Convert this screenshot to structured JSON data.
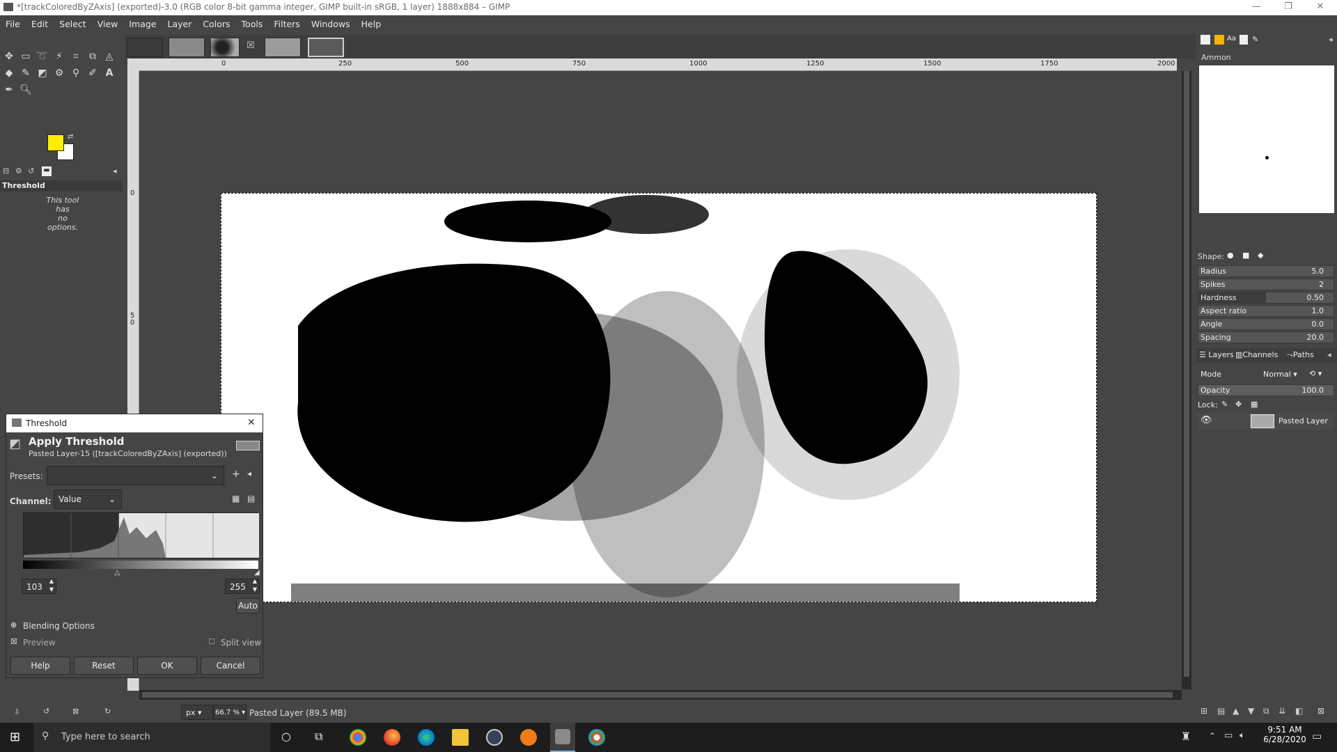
{
  "window": {
    "title": "*[trackColoredByZAxis] (exported)-3.0 (RGB color 8-bit gamma integer, GIMP built-in sRGB, 1 layer) 1888x884 – GIMP",
    "minimize": "—",
    "maximize": "❐",
    "close": "✕"
  },
  "menu": [
    "File",
    "Edit",
    "Select",
    "View",
    "Image",
    "Layer",
    "Colors",
    "Tools",
    "Filters",
    "Windows",
    "Help"
  ],
  "rulers": {
    "top": [
      "0",
      "250",
      "500",
      "750",
      "1000",
      "1250",
      "1500",
      "1750",
      "2000"
    ],
    "left": [
      "0",
      "5",
      "0"
    ]
  },
  "tool_options": {
    "title": "Threshold",
    "note_line1": "This tool has",
    "note_line2": "no options."
  },
  "statusbar": {
    "unit": "px",
    "zoom": "66.7 %",
    "layer_info": "Pasted Layer (89.5 MB)"
  },
  "brush": {
    "name": "Ammon",
    "shape_label": "Shape:",
    "sliders": [
      {
        "label": "Radius",
        "value": "5.0",
        "fraction": 0
      },
      {
        "label": "Spikes",
        "value": "2",
        "fraction": 0
      },
      {
        "label": "Hardness",
        "value": "0.50",
        "fraction": 0.5
      },
      {
        "label": "Aspect ratio",
        "value": "1.0",
        "fraction": 0
      },
      {
        "label": "Angle",
        "value": "0.0",
        "fraction": 0
      },
      {
        "label": "Spacing",
        "value": "20.0",
        "fraction": 0
      }
    ]
  },
  "layers": {
    "tabs": [
      "Layers",
      "Channels",
      "Paths"
    ],
    "mode_label": "Mode",
    "mode_value": "Normal",
    "opacity_label": "Opacity",
    "opacity_value": "100.0",
    "lock_label": "Lock:",
    "layer_name": "Pasted Layer"
  },
  "dialog": {
    "title": "Threshold",
    "heading": "Apply Threshold",
    "subheading": "Pasted Layer-15 ([trackColoredByZAxis] (exported))",
    "presets_label": "Presets:",
    "channel_label": "Channel:",
    "channel_value": "Value",
    "low": "103",
    "high": "255",
    "low_fraction": 0.404,
    "auto": "Auto",
    "blending": "Blending Options",
    "preview": "Preview",
    "split_view": "Split view",
    "buttons": {
      "help": "Help",
      "reset": "Reset",
      "ok": "OK",
      "cancel": "Cancel"
    }
  },
  "taskbar": {
    "search_placeholder": "Type here to search",
    "time": "9:51 AM",
    "date": "6/28/2020"
  }
}
